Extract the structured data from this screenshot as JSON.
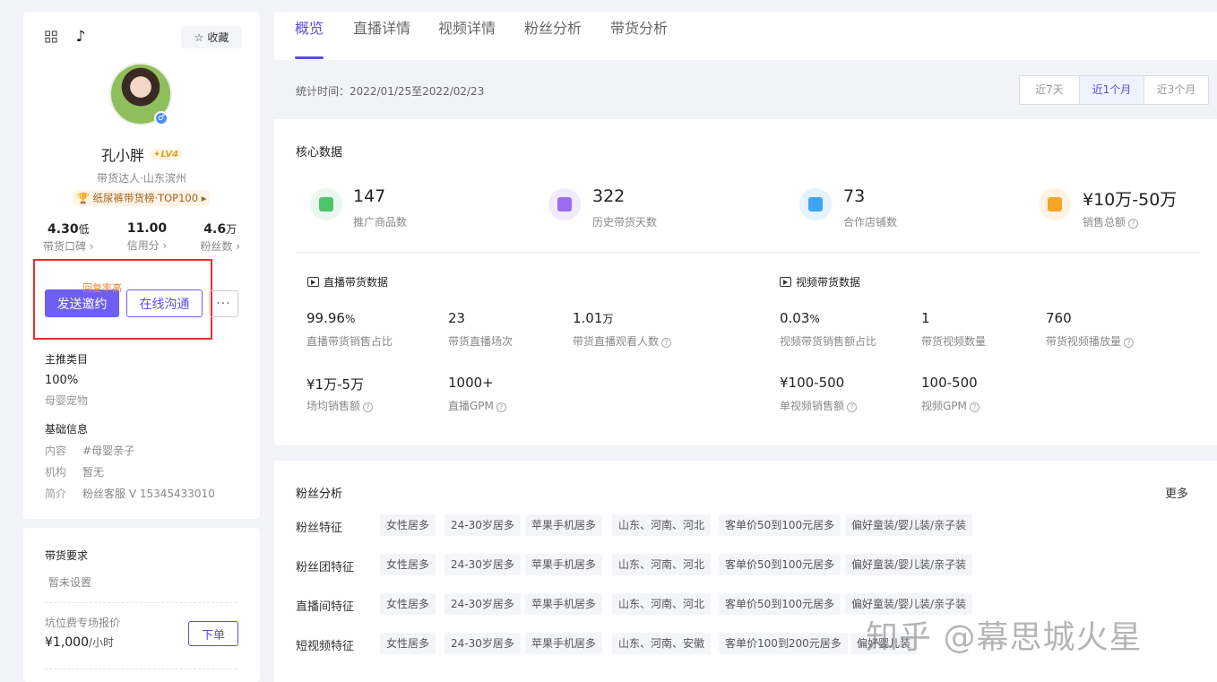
{
  "profile": {
    "favorite_label": "收藏",
    "name": "孔小胖",
    "level": "LV4",
    "subtitle": "带货达人·山东滨州",
    "rank_badge": "纸尿裤带货榜·TOP100",
    "stats": [
      {
        "value": "4.30",
        "unit": "低",
        "label": "带货口碑 ›"
      },
      {
        "value": "11.00",
        "unit": "",
        "label": "信用分 ›"
      },
      {
        "value": "4.6",
        "unit": "万",
        "label": "粉丝数 ›"
      }
    ],
    "reply_hint": "回复率高",
    "send_invite": "发送邀约",
    "online_chat": "在线沟通",
    "more": "···",
    "category_title": "主推类目",
    "category_pct": "100%",
    "category_name": "母婴宠物",
    "basic_title": "基础信息",
    "basic_rows": [
      {
        "k": "内容",
        "v": "#母婴亲子"
      },
      {
        "k": "机构",
        "v": "暂无"
      },
      {
        "k": "简介",
        "v": "粉丝客服 V 15345433010"
      }
    ],
    "req_title": "带货要求",
    "req_value": "暂未设置",
    "pit_title": "坑位费专场报价",
    "pit_price": "¥1,000",
    "pit_unit": "/小时",
    "order_label": "下单"
  },
  "tabs": [
    "概览",
    "直播详情",
    "视频详情",
    "粉丝分析",
    "带货分析"
  ],
  "period_label": "统计时间：2022/01/25至2022/02/23",
  "ranges": [
    "近7天",
    "近1个月",
    "近3个月"
  ],
  "core": {
    "title": "核心数据",
    "metrics": [
      {
        "value": "147",
        "label": "推广商品数",
        "color": "#4cc46b"
      },
      {
        "value": "322",
        "label": "历史带货天数",
        "color": "#9b6cf0"
      },
      {
        "value": "73",
        "label": "合作店铺数",
        "color": "#3ea5f2"
      },
      {
        "value": "¥10万-50万",
        "label": "销售总额",
        "color": "#f5a623"
      }
    ],
    "live_title": "直播带货数据",
    "video_title": "视频带货数据",
    "live": [
      {
        "value": "99.96",
        "unit": "%",
        "label": "直播带货销售占比"
      },
      {
        "value": "23",
        "unit": "",
        "label": "带货直播场次"
      },
      {
        "value": "1.01",
        "unit": "万",
        "label": "带货直播观看人数"
      },
      {
        "value": "¥1万-5万",
        "unit": "",
        "label": "场均销售额"
      },
      {
        "value": "1000+",
        "unit": "",
        "label": "直播GPM"
      }
    ],
    "video": [
      {
        "value": "0.03",
        "unit": "%",
        "label": "视频带货销售额占比"
      },
      {
        "value": "1",
        "unit": "",
        "label": "带货视频数量"
      },
      {
        "value": "760",
        "unit": "",
        "label": "带货视频播放量"
      },
      {
        "value": "¥100-500",
        "unit": "",
        "label": "单视频销售额"
      },
      {
        "value": "100-500",
        "unit": "",
        "label": "视频GPM"
      }
    ]
  },
  "fans": {
    "title": "粉丝分析",
    "more": "更多",
    "rows": [
      {
        "label": "粉丝特征",
        "tags": [
          "女性居多",
          "24-30岁居多",
          "苹果手机居多",
          "山东、河南、河北",
          "客单价50到100元居多",
          "偏好童装/婴儿装/亲子装"
        ]
      },
      {
        "label": "粉丝团特征",
        "tags": [
          "女性居多",
          "24-30岁居多",
          "苹果手机居多",
          "山东、河南、河北",
          "客单价50到100元居多",
          "偏好童装/婴儿装/亲子装"
        ]
      },
      {
        "label": "直播间特征",
        "tags": [
          "女性居多",
          "24-30岁居多",
          "苹果手机居多",
          "山东、河南、河北",
          "客单价50到100元居多",
          "偏好童装/婴儿装/亲子装"
        ]
      },
      {
        "label": "短视频特征",
        "tags": [
          "女性居多",
          "24-30岁居多",
          "苹果手机居多",
          "山东、河南、安徽",
          "客单价100到200元居多",
          "偏好婴儿装"
        ]
      }
    ]
  },
  "watermark": "知乎 @幕思城火星"
}
